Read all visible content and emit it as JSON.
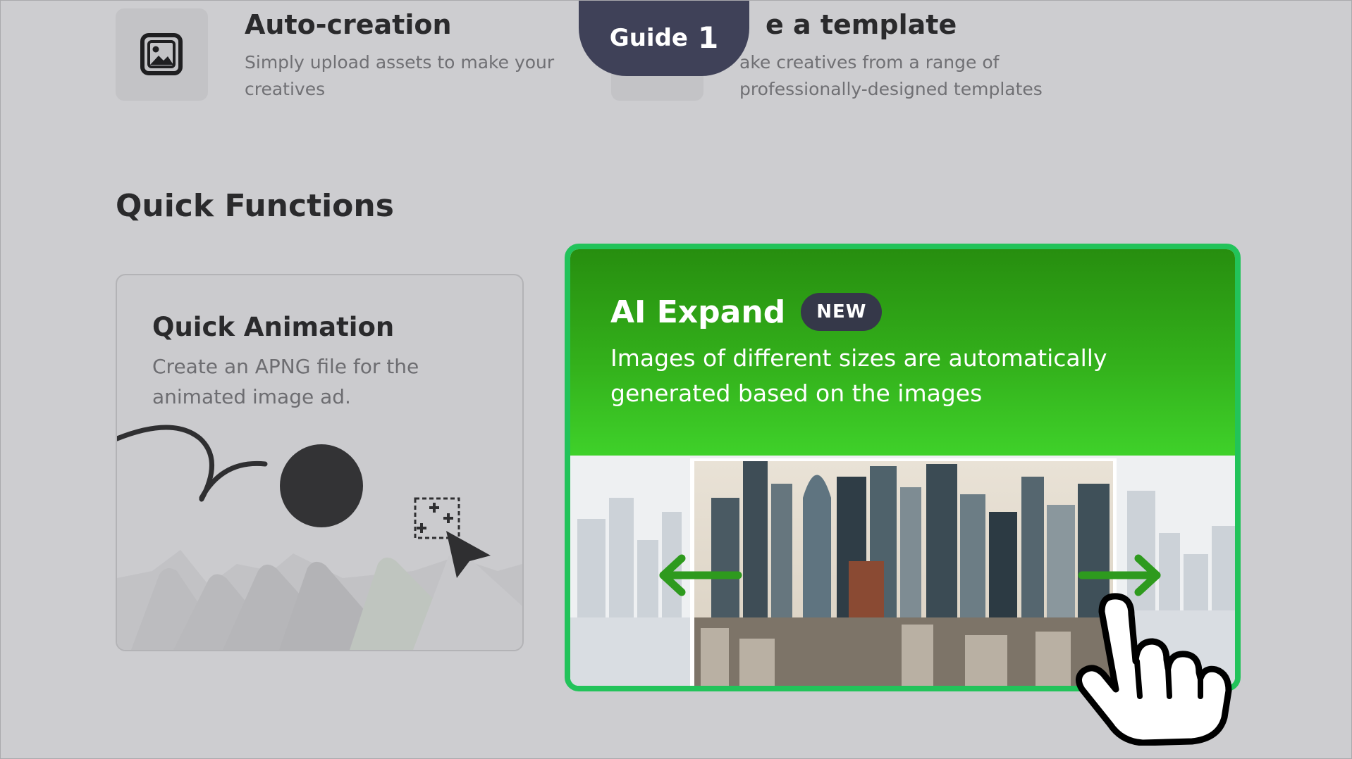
{
  "guide": {
    "label": "Guide",
    "step": "1"
  },
  "options": [
    {
      "title": "Auto-creation",
      "description": "Simply upload assets to make your creatives",
      "icon": "image-icon"
    },
    {
      "title": "e a template",
      "description": "ake creatives from a range of professionally-designed templates",
      "icon": "template-icon"
    }
  ],
  "quick_functions": {
    "heading": "Quick Functions",
    "quick_animation": {
      "title": "Quick Animation",
      "description": "Create an APNG file for the animated image ad."
    },
    "ai_expand": {
      "title": "AI Expand",
      "badge": "NEW",
      "description": "Images of different sizes are automatically generated based on the images"
    }
  },
  "colors": {
    "background": "#cdcdd0",
    "guide_pill": "#3f4158",
    "ai_card_border": "#22c35a",
    "ai_card_gradient_top": "#278e0f",
    "ai_card_gradient_bottom": "#3fd12a",
    "badge_bg": "#353849",
    "arrow_green": "#2e9a1e"
  }
}
